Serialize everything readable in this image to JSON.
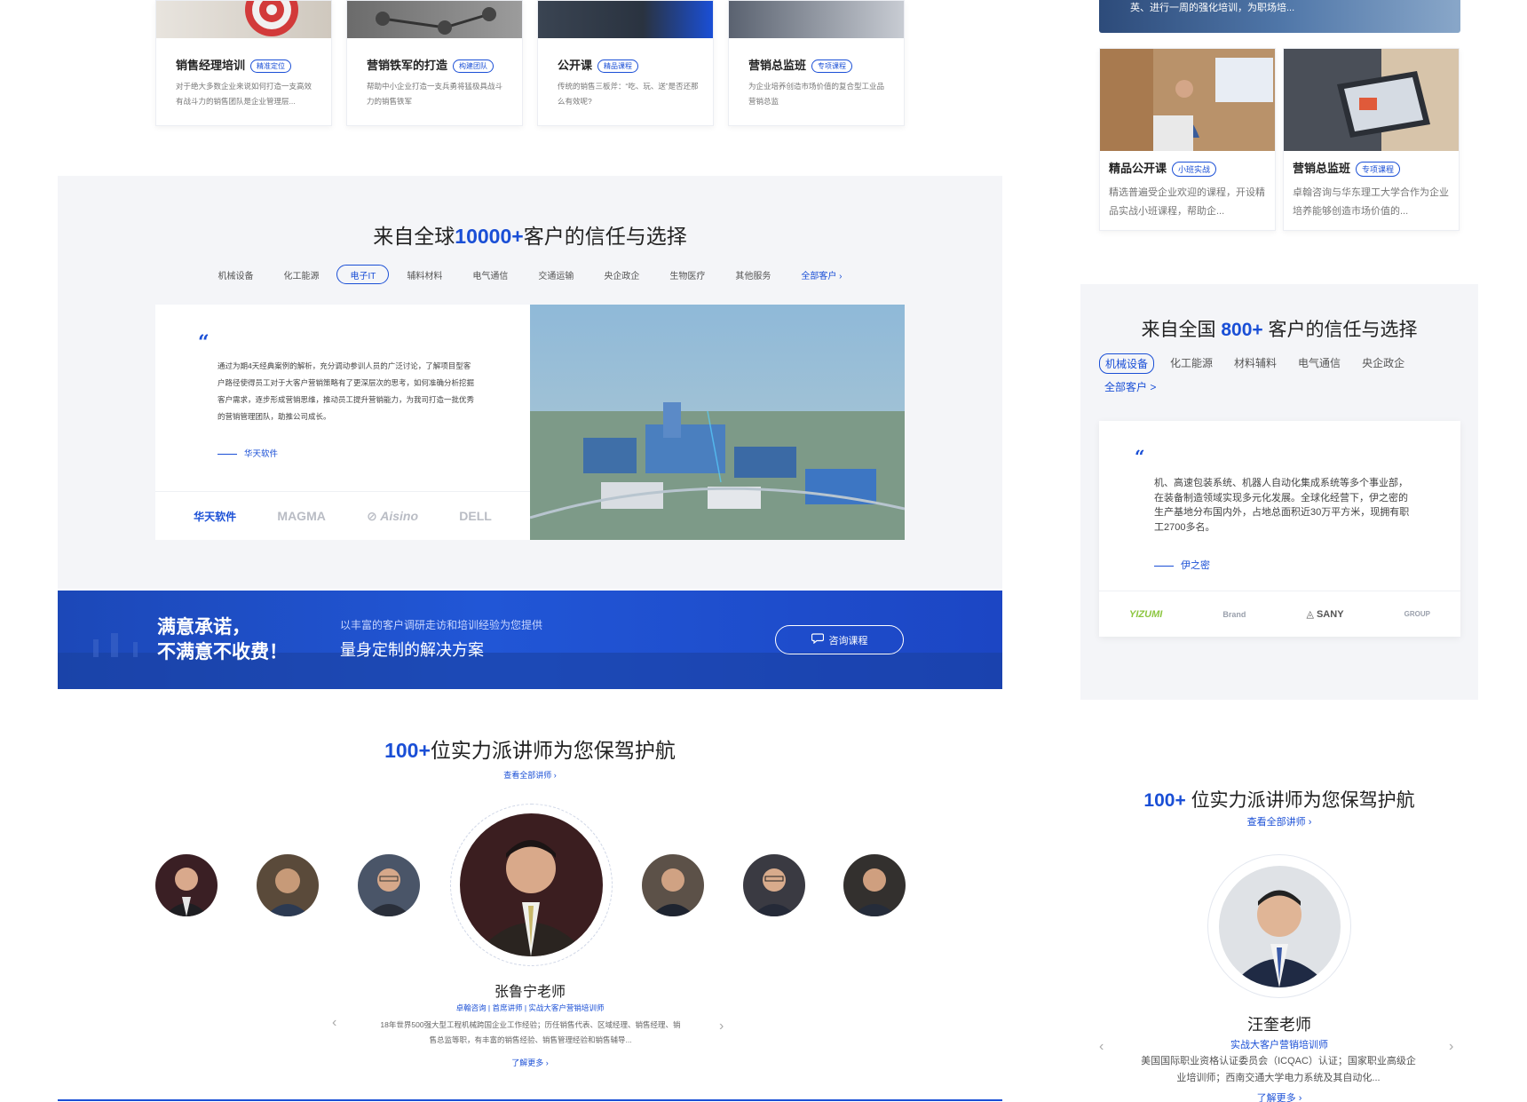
{
  "course_cards": [
    {
      "title": "销售经理培训",
      "badge": "精准定位",
      "desc": "对于绝大多数企业来说如何打造一支高效有战斗力的销售团队是企业管理层..."
    },
    {
      "title": "营销铁军的打造",
      "badge": "构建团队",
      "desc": "帮助中小企业打造一支兵勇将猛极具战斗力的销售铁军"
    },
    {
      "title": "公开课",
      "badge": "精品课程",
      "desc": "传统的销售三板斧：“吃、玩、送”是否还那么有效呢?"
    },
    {
      "title": "营销总监班",
      "badge": "专项课程",
      "desc": "为企业培养创造市场价值的复合型工业品营销总监"
    }
  ],
  "trust_left": {
    "title_pre": "来自全球",
    "title_num": "10000+",
    "title_post": "客户的信任与选择",
    "tabs": [
      "机械设备",
      "化工能源",
      "电子IT",
      "辅料材料",
      "电气通信",
      "交通运输",
      "央企政企",
      "生物医疗",
      "其他服务"
    ],
    "tab_all": "全部客户",
    "quote": "通过为期4天经典案例的解析，充分调动参训人员的广泛讨论，了解项目型客户路径使得员工对于大客户营销策略有了更深层次的思考，如何准确分析挖掘客户需求，逐步形成营销思维，推动员工提升营销能力，为我司打造一批优秀的营销管理团队，助推公司成长。",
    "author": "华天软件",
    "logos": [
      "华天软件",
      "MAGMA",
      "Aisino",
      "DELL"
    ]
  },
  "banner": {
    "title_line1": "满意承诺，",
    "title_line2": "不满意不收费！",
    "sub_small": "以丰富的客户调研走访和培训经验为您提供",
    "sub_big": "量身定制的解决方案",
    "button": "咨询课程"
  },
  "lecturers_left": {
    "title_num": "100+",
    "title_text": "位实力派讲师为您保驾护航",
    "view_all": "查看全部讲师",
    "name": "张鲁宁老师",
    "tags": "卓翰咨询 | 首席讲师 | 实战大客户营销培训师",
    "desc": "18年世界500强大型工程机械跨国企业工作经验；历任销售代表、区域经理、销售经理、销售总监等职，有丰富的销售经验、销售管理经验和销售辅导...",
    "more": "了解更多"
  },
  "right_column": {
    "top_caption": "英、进行一周的强化培训，为职场培...",
    "cards": [
      {
        "title": "精品公开课",
        "badge": "小班实战",
        "desc": "精选普遍受企业欢迎的课程，开设精品实战小班课程，帮助企..."
      },
      {
        "title": "营销总监班",
        "badge": "专项课程",
        "desc": "卓翰咨询与华东理工大学合作为企业培养能够创造市场价值的..."
      }
    ],
    "trust": {
      "title_pre": "来自全国",
      "title_num": "800+",
      "title_post": "客户的信任与选择",
      "tabs": [
        "机械设备",
        "化工能源",
        "材料辅料",
        "电气通信",
        "央企政企"
      ],
      "tab_all": "全部客户 >",
      "quote": "机、高速包装系统、机器人自动化集成系统等多个事业部，在装备制造领域实现多元化发展。全球化经营下，伊之密的生产基地分布国内外，占地总面积近30万平方米，现拥有职工2700多名。",
      "author": "伊之密",
      "logos": [
        "YIZUMI",
        "Brand",
        "SANY",
        "GROUP"
      ]
    },
    "lecturers": {
      "title_num": "100+",
      "title_text": "位实力派讲师为您保驾护航",
      "view_all": "查看全部讲师",
      "name": "汪奎老师",
      "tag": "实战大客户营销培训师",
      "desc": "美国国际职业资格认证委员会（ICQAC）认证；国家职业高级企业培训师；西南交通大学电力系统及其自动化...",
      "more": "了解更多"
    }
  },
  "colors": {
    "accent": "#1a4fd6",
    "gray_bg": "#f4f5f8",
    "banner_blue": "#2156d6"
  }
}
